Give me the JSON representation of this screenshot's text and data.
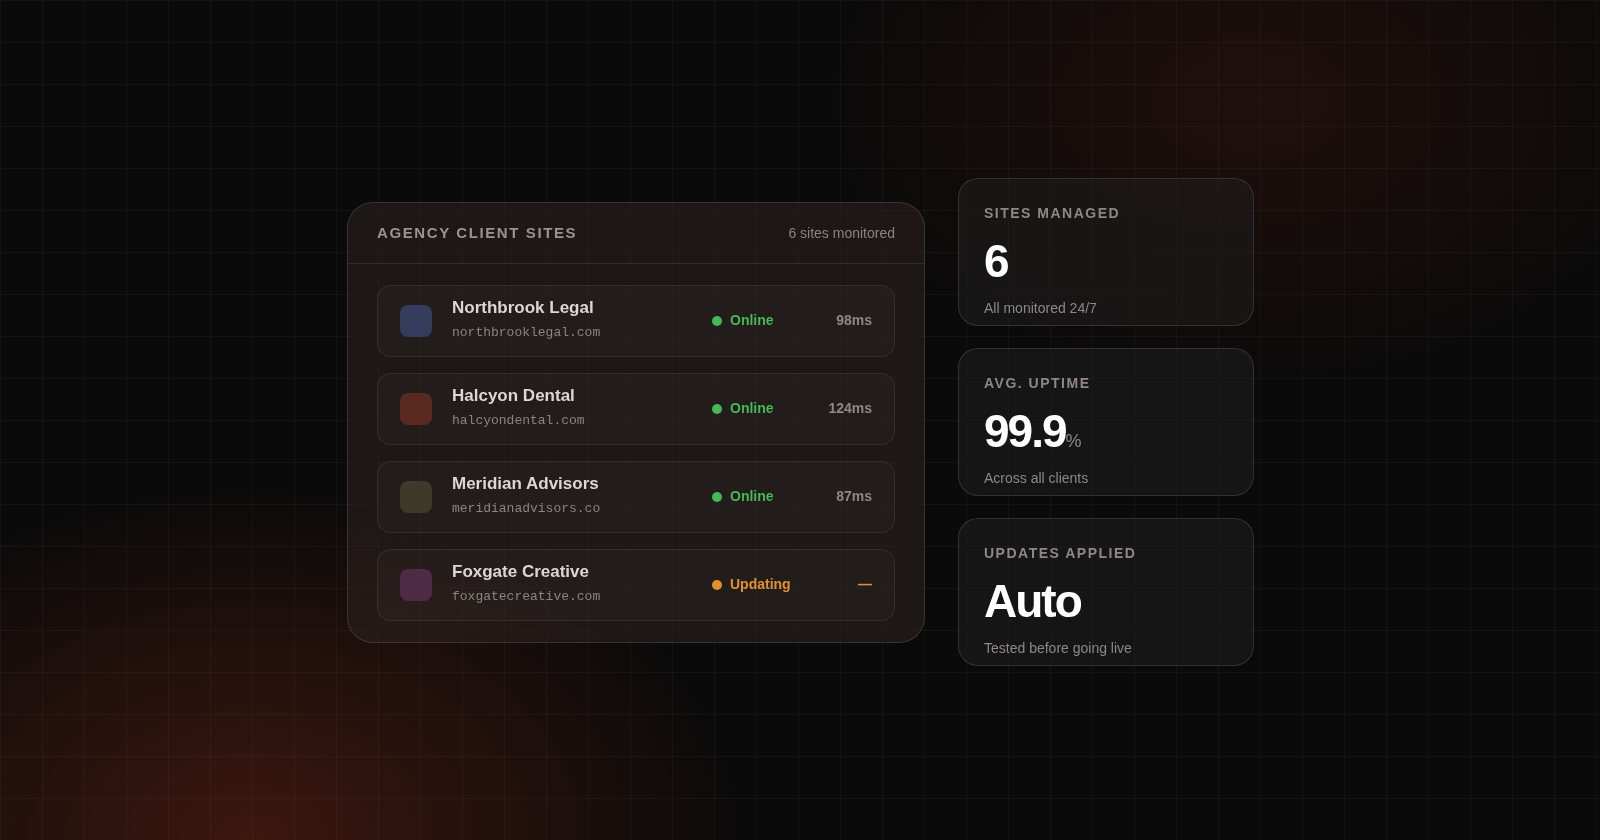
{
  "panel": {
    "title": "AGENCY CLIENT SITES",
    "count": "6 sites monitored",
    "sites": [
      {
        "name": "Northbrook Legal",
        "domain": "northbrooklegal.com",
        "color": "#353b5c",
        "kind": "online",
        "status_label": "Online",
        "latency": "98ms"
      },
      {
        "name": "Halcyon Dental",
        "domain": "halcyondental.com",
        "color": "#5a2a20",
        "kind": "online",
        "status_label": "Online",
        "latency": "124ms"
      },
      {
        "name": "Meridian Advisors",
        "domain": "meridianadvisors.co",
        "color": "#3d3a2a",
        "kind": "online",
        "status_label": "Online",
        "latency": "87ms"
      },
      {
        "name": "Foxgate Creative",
        "domain": "foxgatecreative.com",
        "color": "#4e2c45",
        "kind": "updating",
        "status_label": "Updating",
        "latency": "—"
      }
    ]
  },
  "stats": [
    {
      "label": "SITES MANAGED",
      "value": "6",
      "caption": "All monitored 24/7"
    },
    {
      "label": "AVG. UPTIME",
      "value": "99.9",
      "unit": "%",
      "caption": "Across all clients"
    },
    {
      "label": "UPDATES APPLIED",
      "value": "Auto",
      "caption": "Tested before going live"
    }
  ]
}
